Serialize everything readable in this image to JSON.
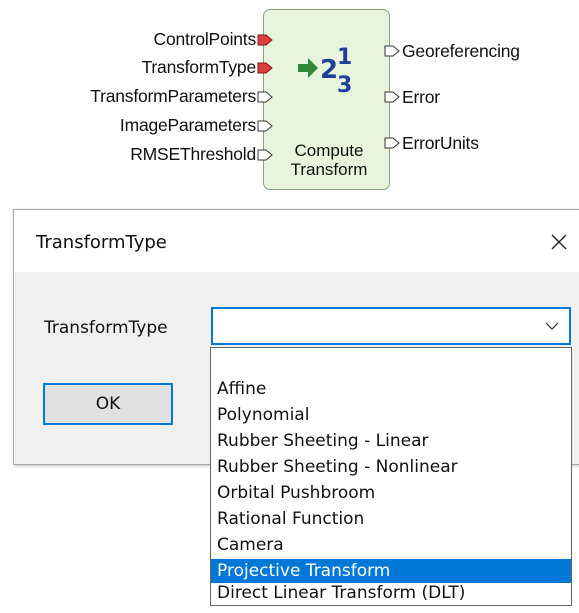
{
  "node": {
    "inputs": [
      {
        "label": "ControlPoints",
        "required": true
      },
      {
        "label": "TransformType",
        "required": true
      },
      {
        "label": "TransformParameters",
        "required": false
      },
      {
        "label": "ImageParameters",
        "required": false
      },
      {
        "label": "RMSEThreshold",
        "required": false
      }
    ],
    "outputs": [
      {
        "label": "Georeferencing"
      },
      {
        "label": "Error"
      },
      {
        "label": "ErrorUnits"
      }
    ],
    "caption_line1": "Compute",
    "caption_line2": "Transform",
    "icon": "compute-transform-icon",
    "colors": {
      "required_port": "#e03c3c",
      "node_fill": "#e8f4dc",
      "icon_arrow": "#2e8b3a",
      "icon_digits": "#1f3f9c"
    }
  },
  "dialog": {
    "title": "TransformType",
    "field_label": "TransformType",
    "combo_value": "",
    "ok_label": "OK",
    "close_icon": "close-icon",
    "colors": {
      "focus": "#0078d7"
    }
  },
  "dropdown": {
    "options": [
      "",
      "Affine",
      "Polynomial",
      "Rubber Sheeting - Linear",
      "Rubber Sheeting - Nonlinear",
      "Orbital Pushbroom",
      "Rational Function",
      "Camera",
      "Projective Transform",
      "Direct Linear Transform (DLT)"
    ],
    "highlighted": "Projective Transform"
  }
}
